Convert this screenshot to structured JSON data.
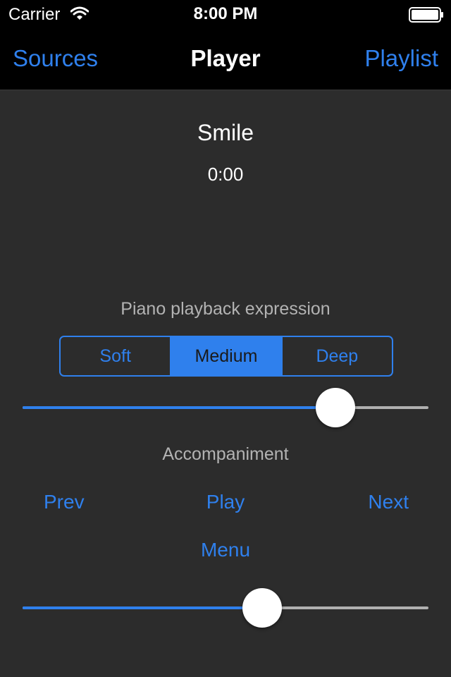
{
  "status_bar": {
    "carrier": "Carrier",
    "time": "8:00 PM",
    "wifi_icon": "wifi-icon",
    "battery_icon": "battery-icon"
  },
  "nav": {
    "left": "Sources",
    "title": "Player",
    "right": "Playlist"
  },
  "song": {
    "title": "Smile",
    "time": "0:00"
  },
  "expression": {
    "label": "Piano playback expression",
    "segments": [
      "Soft",
      "Medium",
      "Deep"
    ],
    "selected": "Medium",
    "slider_value": 0.77
  },
  "accompaniment": {
    "label": "Accompaniment",
    "prev": "Prev",
    "play": "Play",
    "next": "Next",
    "menu": "Menu",
    "slider_value": 0.59
  },
  "colors": {
    "accent": "#2f80ed",
    "background": "#2c2c2c",
    "bar": "#000000"
  }
}
